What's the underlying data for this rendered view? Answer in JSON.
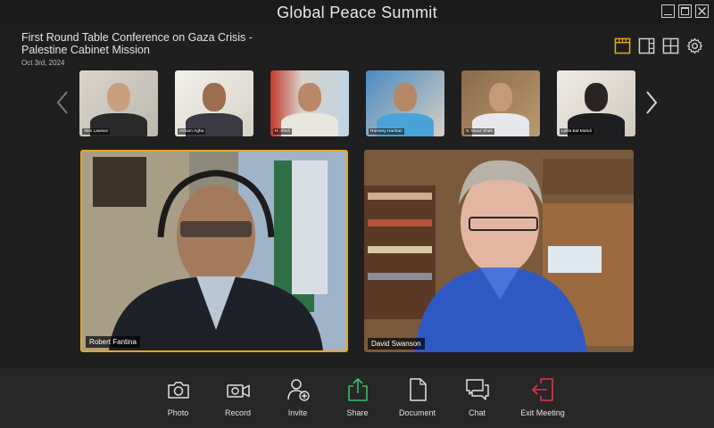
{
  "window": {
    "title": "Global Peace Summit"
  },
  "meeting": {
    "title": "First Round Table Conference on Gaza Crisis - Palestine Cabinet Mission",
    "date": "Oct 3rd, 2024"
  },
  "layout_icons": [
    "speaker-layout-icon",
    "sidebar-layout-icon",
    "grid-layout-icon",
    "settings-gear-icon"
  ],
  "participants": [
    {
      "name": "Alex Lawson"
    },
    {
      "name": "Asham Agha"
    },
    {
      "name": "H. Sholi"
    },
    {
      "name": "Ramsey Hanhan"
    },
    {
      "name": "S. Muaz Shah"
    },
    {
      "name": "Lailla Bal Mahdi"
    }
  ],
  "main_speakers": [
    {
      "name": "Robert Fantina",
      "active": true
    },
    {
      "name": "David Swanson",
      "active": false
    }
  ],
  "toolbar": {
    "photo": "Photo",
    "record": "Record",
    "invite": "Invite",
    "share": "Share",
    "document": "Document",
    "chat": "Chat",
    "exit": "Exit Meeting"
  },
  "colors": {
    "accent": "#e6a623",
    "share": "#3dbb6a",
    "exit": "#e0344d",
    "background": "#1f1f1f",
    "toolbar": "#272727"
  }
}
